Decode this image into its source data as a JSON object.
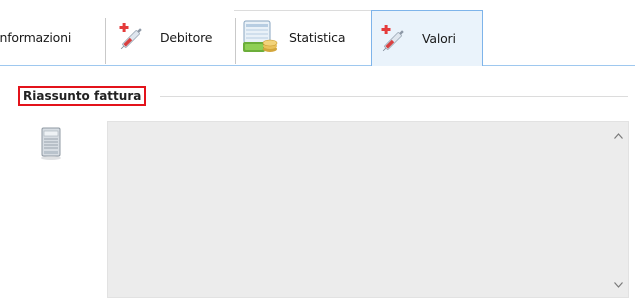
{
  "tabs": [
    {
      "label": "Informazioni",
      "icon": "none",
      "active": false
    },
    {
      "label": "Debitore",
      "icon": "syringe-icon",
      "active": false
    },
    {
      "label": "Statistica",
      "icon": "statistics-icon",
      "active": false
    },
    {
      "label": "Valori",
      "icon": "syringe-icon",
      "active": true
    }
  ],
  "section": {
    "title": "Riassunto fattura",
    "highlight_color": "#e3131b"
  },
  "summary": {
    "icon": "document-icon",
    "value": ""
  },
  "colors": {
    "active_tab_bg": "#eaf3fb",
    "active_tab_border": "#7eb4ea",
    "textarea_bg": "#ececec"
  }
}
